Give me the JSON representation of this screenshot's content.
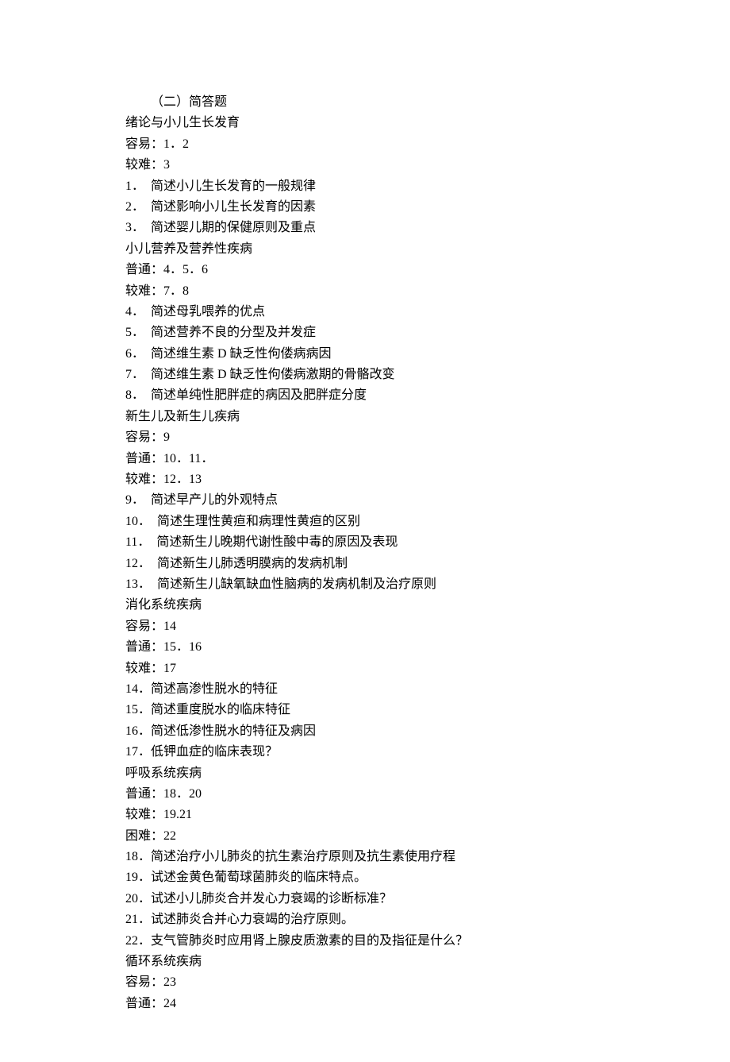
{
  "lines": [
    {
      "text": "（二）简答题",
      "indent": true
    },
    {
      "text": "绪论与小儿生长发育"
    },
    {
      "text": "容易：1．2"
    },
    {
      "text": "较难：3"
    },
    {
      "text": "1．  简述小儿生长发育的一般规律"
    },
    {
      "text": "2．  简述影响小儿生长发育的因素"
    },
    {
      "text": "3．  简述婴儿期的保健原则及重点"
    },
    {
      "text": "小儿营养及营养性疾病"
    },
    {
      "text": "普通：4．5．6"
    },
    {
      "text": "较难：7．8"
    },
    {
      "text": "4．  简述母乳喂养的优点"
    },
    {
      "text": "5．  简述营养不良的分型及并发症"
    },
    {
      "text": "6．  简述维生素 D 缺乏性佝偻病病因"
    },
    {
      "text": "7．  简述维生素 D 缺乏性佝偻病激期的骨骼改变"
    },
    {
      "text": "8．  简述单纯性肥胖症的病因及肥胖症分度"
    },
    {
      "text": "新生儿及新生儿疾病"
    },
    {
      "text": "容易：9"
    },
    {
      "text": "普通：10．11．"
    },
    {
      "text": "较难：12．13"
    },
    {
      "text": "9．  简述早产儿的外观特点"
    },
    {
      "text": "10．  简述生理性黄疸和病理性黄疸的区别"
    },
    {
      "text": "11．  简述新生儿晚期代谢性酸中毒的原因及表现"
    },
    {
      "text": "12．  简述新生儿肺透明膜病的发病机制"
    },
    {
      "text": "13．  简述新生儿缺氧缺血性脑病的发病机制及治疗原则"
    },
    {
      "text": "消化系统疾病"
    },
    {
      "text": "容易：14"
    },
    {
      "text": "普通：15．16"
    },
    {
      "text": "较难：17"
    },
    {
      "text": "14．简述高渗性脱水的特征"
    },
    {
      "text": "15．简述重度脱水的临床特征"
    },
    {
      "text": "16．简述低渗性脱水的特征及病因"
    },
    {
      "text": "17．低钾血症的临床表现？"
    },
    {
      "text": "呼吸系统疾病"
    },
    {
      "text": "普通：18．20"
    },
    {
      "text": "较难：19.21"
    },
    {
      "text": "困难：22"
    },
    {
      "text": "18．简述治疗小儿肺炎的抗生素治疗原则及抗生素使用疗程"
    },
    {
      "text": "19．试述金黄色葡萄球菌肺炎的临床特点。"
    },
    {
      "text": "20．试述小儿肺炎合并发心力衰竭的诊断标准？"
    },
    {
      "text": "21．试述肺炎合并心力衰竭的治疗原则。"
    },
    {
      "text": "22．支气管肺炎时应用肾上腺皮质激素的目的及指征是什么？"
    },
    {
      "text": "循环系统疾病"
    },
    {
      "text": "容易：23"
    },
    {
      "text": "普通：24"
    }
  ]
}
